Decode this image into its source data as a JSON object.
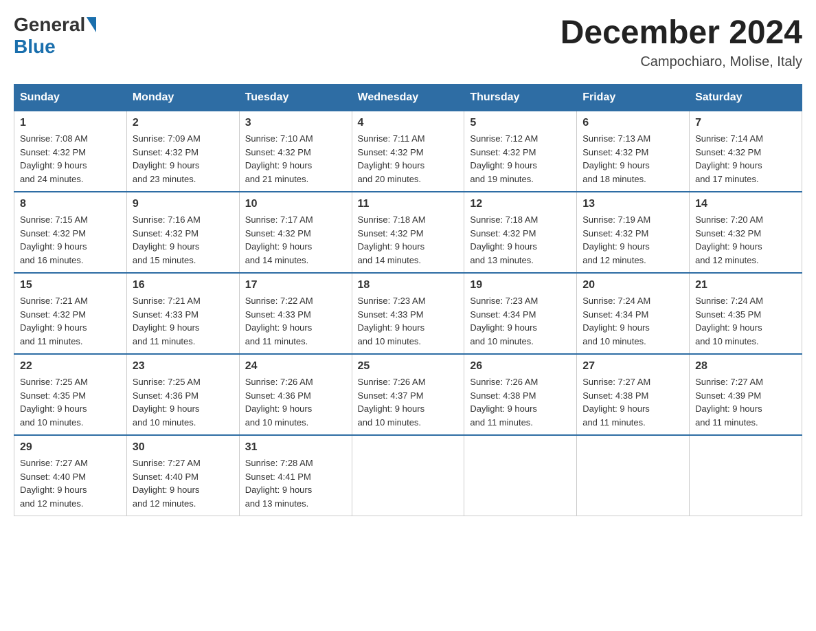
{
  "header": {
    "logo_general": "General",
    "logo_blue": "Blue",
    "month_title": "December 2024",
    "location": "Campochiaro, Molise, Italy"
  },
  "weekdays": [
    "Sunday",
    "Monday",
    "Tuesday",
    "Wednesday",
    "Thursday",
    "Friday",
    "Saturday"
  ],
  "weeks": [
    [
      {
        "day": "1",
        "sunrise": "7:08 AM",
        "sunset": "4:32 PM",
        "daylight": "9 hours and 24 minutes."
      },
      {
        "day": "2",
        "sunrise": "7:09 AM",
        "sunset": "4:32 PM",
        "daylight": "9 hours and 23 minutes."
      },
      {
        "day": "3",
        "sunrise": "7:10 AM",
        "sunset": "4:32 PM",
        "daylight": "9 hours and 21 minutes."
      },
      {
        "day": "4",
        "sunrise": "7:11 AM",
        "sunset": "4:32 PM",
        "daylight": "9 hours and 20 minutes."
      },
      {
        "day": "5",
        "sunrise": "7:12 AM",
        "sunset": "4:32 PM",
        "daylight": "9 hours and 19 minutes."
      },
      {
        "day": "6",
        "sunrise": "7:13 AM",
        "sunset": "4:32 PM",
        "daylight": "9 hours and 18 minutes."
      },
      {
        "day": "7",
        "sunrise": "7:14 AM",
        "sunset": "4:32 PM",
        "daylight": "9 hours and 17 minutes."
      }
    ],
    [
      {
        "day": "8",
        "sunrise": "7:15 AM",
        "sunset": "4:32 PM",
        "daylight": "9 hours and 16 minutes."
      },
      {
        "day": "9",
        "sunrise": "7:16 AM",
        "sunset": "4:32 PM",
        "daylight": "9 hours and 15 minutes."
      },
      {
        "day": "10",
        "sunrise": "7:17 AM",
        "sunset": "4:32 PM",
        "daylight": "9 hours and 14 minutes."
      },
      {
        "day": "11",
        "sunrise": "7:18 AM",
        "sunset": "4:32 PM",
        "daylight": "9 hours and 14 minutes."
      },
      {
        "day": "12",
        "sunrise": "7:18 AM",
        "sunset": "4:32 PM",
        "daylight": "9 hours and 13 minutes."
      },
      {
        "day": "13",
        "sunrise": "7:19 AM",
        "sunset": "4:32 PM",
        "daylight": "9 hours and 12 minutes."
      },
      {
        "day": "14",
        "sunrise": "7:20 AM",
        "sunset": "4:32 PM",
        "daylight": "9 hours and 12 minutes."
      }
    ],
    [
      {
        "day": "15",
        "sunrise": "7:21 AM",
        "sunset": "4:32 PM",
        "daylight": "9 hours and 11 minutes."
      },
      {
        "day": "16",
        "sunrise": "7:21 AM",
        "sunset": "4:33 PM",
        "daylight": "9 hours and 11 minutes."
      },
      {
        "day": "17",
        "sunrise": "7:22 AM",
        "sunset": "4:33 PM",
        "daylight": "9 hours and 11 minutes."
      },
      {
        "day": "18",
        "sunrise": "7:23 AM",
        "sunset": "4:33 PM",
        "daylight": "9 hours and 10 minutes."
      },
      {
        "day": "19",
        "sunrise": "7:23 AM",
        "sunset": "4:34 PM",
        "daylight": "9 hours and 10 minutes."
      },
      {
        "day": "20",
        "sunrise": "7:24 AM",
        "sunset": "4:34 PM",
        "daylight": "9 hours and 10 minutes."
      },
      {
        "day": "21",
        "sunrise": "7:24 AM",
        "sunset": "4:35 PM",
        "daylight": "9 hours and 10 minutes."
      }
    ],
    [
      {
        "day": "22",
        "sunrise": "7:25 AM",
        "sunset": "4:35 PM",
        "daylight": "9 hours and 10 minutes."
      },
      {
        "day": "23",
        "sunrise": "7:25 AM",
        "sunset": "4:36 PM",
        "daylight": "9 hours and 10 minutes."
      },
      {
        "day": "24",
        "sunrise": "7:26 AM",
        "sunset": "4:36 PM",
        "daylight": "9 hours and 10 minutes."
      },
      {
        "day": "25",
        "sunrise": "7:26 AM",
        "sunset": "4:37 PM",
        "daylight": "9 hours and 10 minutes."
      },
      {
        "day": "26",
        "sunrise": "7:26 AM",
        "sunset": "4:38 PM",
        "daylight": "9 hours and 11 minutes."
      },
      {
        "day": "27",
        "sunrise": "7:27 AM",
        "sunset": "4:38 PM",
        "daylight": "9 hours and 11 minutes."
      },
      {
        "day": "28",
        "sunrise": "7:27 AM",
        "sunset": "4:39 PM",
        "daylight": "9 hours and 11 minutes."
      }
    ],
    [
      {
        "day": "29",
        "sunrise": "7:27 AM",
        "sunset": "4:40 PM",
        "daylight": "9 hours and 12 minutes."
      },
      {
        "day": "30",
        "sunrise": "7:27 AM",
        "sunset": "4:40 PM",
        "daylight": "9 hours and 12 minutes."
      },
      {
        "day": "31",
        "sunrise": "7:28 AM",
        "sunset": "4:41 PM",
        "daylight": "9 hours and 13 minutes."
      },
      null,
      null,
      null,
      null
    ]
  ],
  "labels": {
    "sunrise": "Sunrise:",
    "sunset": "Sunset:",
    "daylight": "Daylight:"
  }
}
